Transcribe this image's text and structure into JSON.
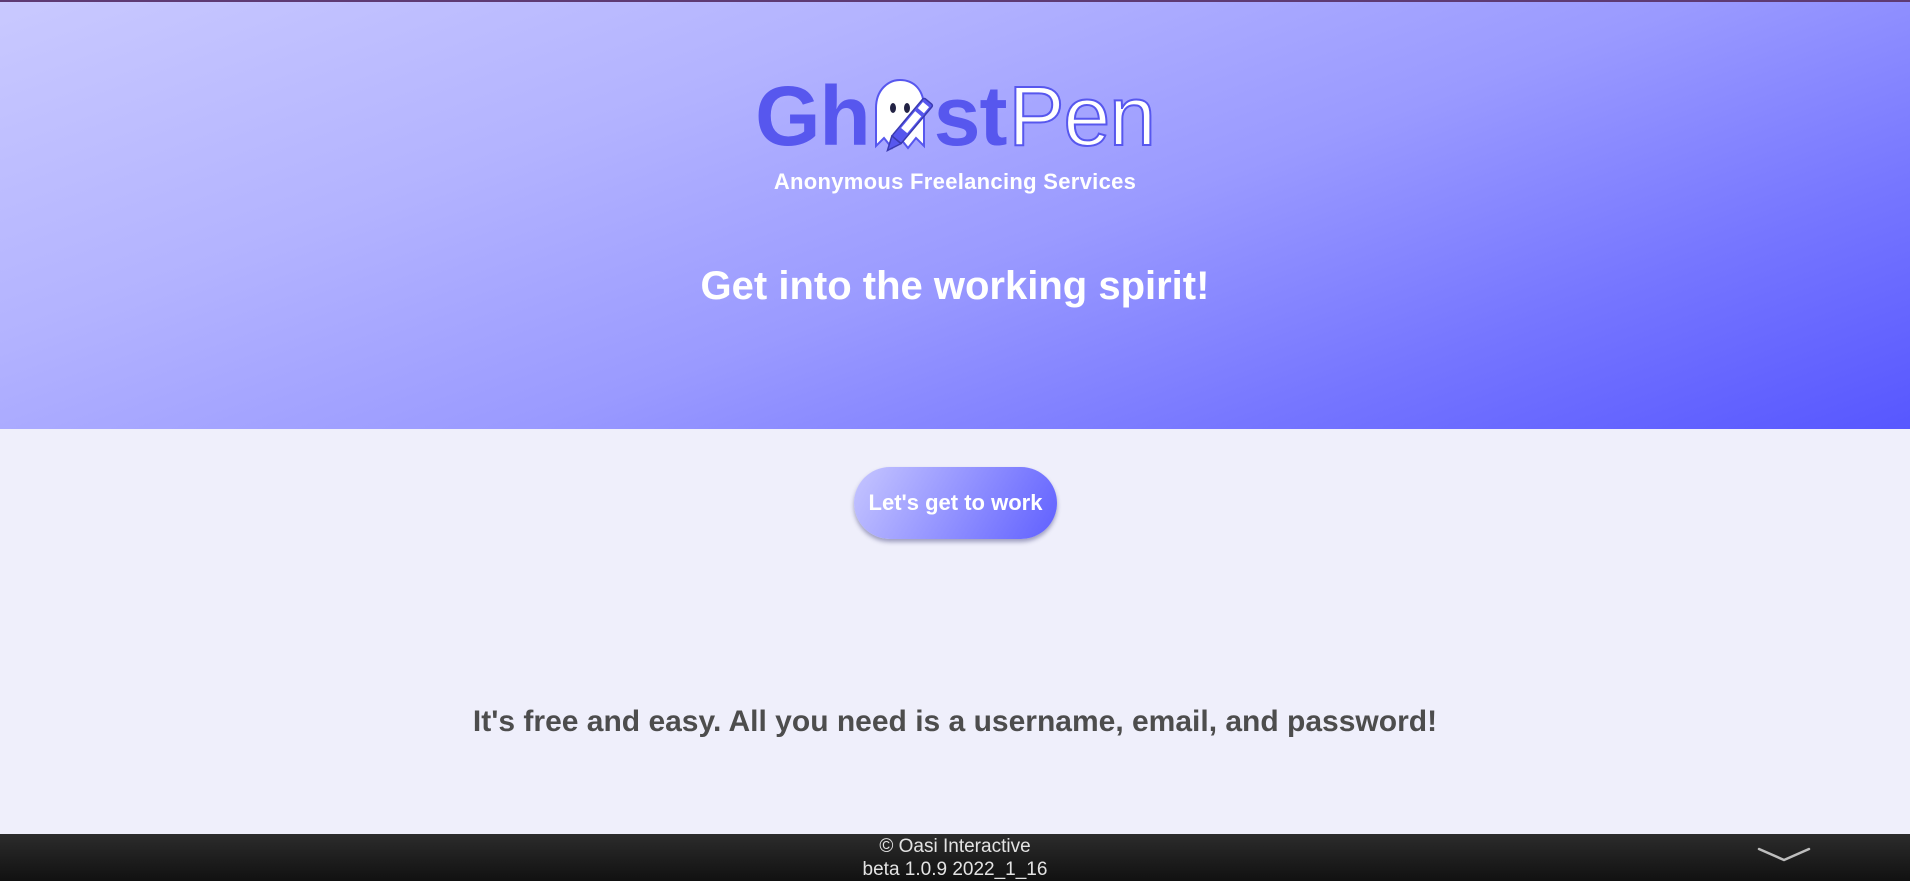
{
  "logo": {
    "text_a": "Gh",
    "text_b": "st",
    "text_c": "Pen",
    "icon": "ghost-with-pen-icon",
    "brand_color": "#5757ee"
  },
  "hero": {
    "tagline": "Anonymous Freelancing Services",
    "headline": "Get into the working spirit!"
  },
  "cta": {
    "label": "Let's get to work"
  },
  "info": {
    "text": "It's free and easy. All you need is a username, email, and password!"
  },
  "footer": {
    "copyright": "© Oasi Interactive",
    "version": "beta 1.0.9 2022_1_16",
    "toggle_icon": "chevron-down-icon"
  }
}
